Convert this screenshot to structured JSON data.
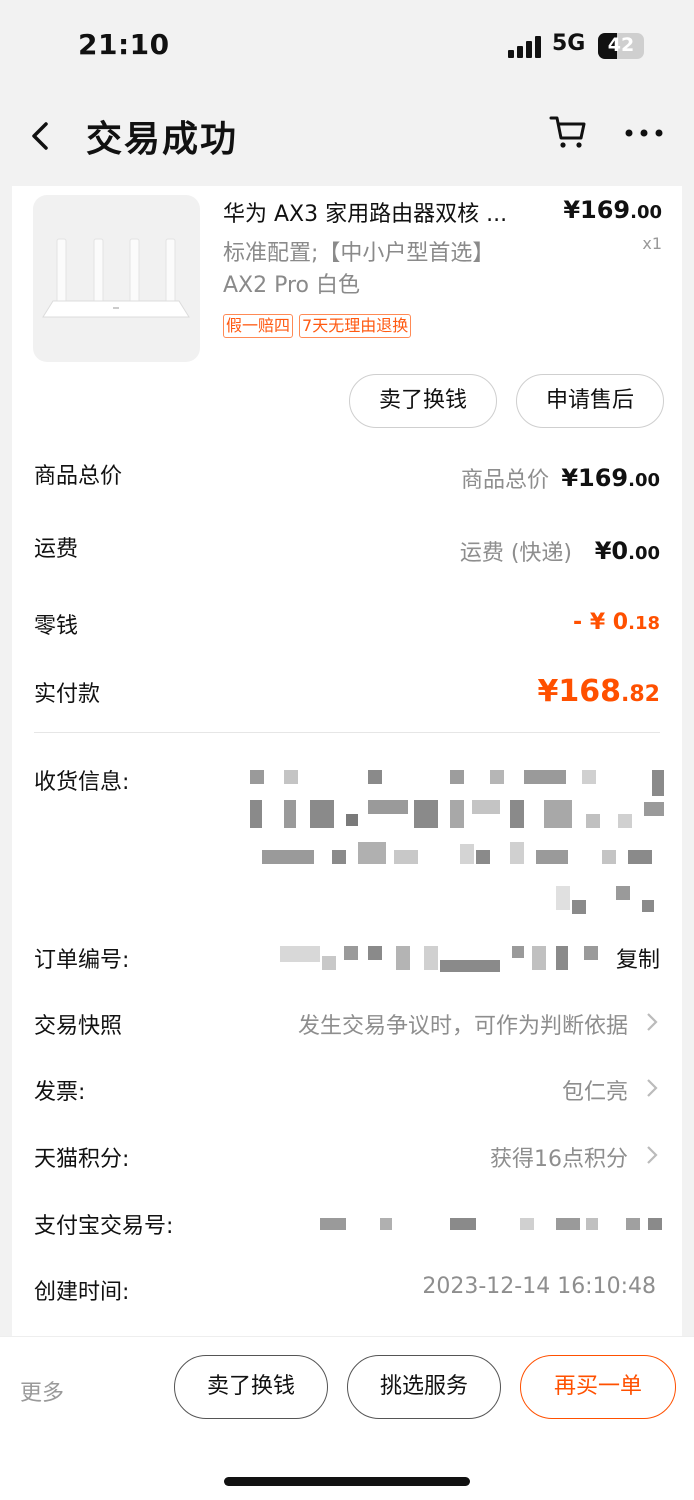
{
  "status_bar": {
    "time": "21:10",
    "network": "5G",
    "battery": "42",
    "battery_level": 0.42
  },
  "nav": {
    "title": "交易成功",
    "icons": [
      "back-icon",
      "cart-icon",
      "more-icon"
    ]
  },
  "product": {
    "title": "华为 AX3 家用路由器双核 ...",
    "price_main": "¥169",
    "price_dec": ".00",
    "qty": "x1",
    "spec_line1": "标准配置;【中小户型首选】",
    "spec_line2": "AX2 Pro 白色",
    "tags": [
      "假一赔四",
      "7天无理由退换"
    ],
    "actions": [
      "卖了换钱",
      "申请售后"
    ]
  },
  "summary": {
    "goods_total": {
      "label": "商品总价",
      "sub": "商品总价",
      "int": "¥169",
      "dec": ".00"
    },
    "shipping": {
      "label": "运费",
      "sub": "运费 (快递)",
      "int": "¥0",
      "dec": ".00"
    },
    "change": {
      "label": "零钱",
      "int": "- ¥ 0",
      "dec": ".18"
    },
    "paid": {
      "label": "实付款",
      "int": "¥168",
      "dec": ".82"
    }
  },
  "info": {
    "address_label": "收货信息:",
    "order_no_label": "订单编号:",
    "copy": "复制",
    "snapshot_label": "交易快照",
    "snapshot_value": "发生交易争议时，可作为判断依据",
    "invoice_label": "发票:",
    "invoice_value": "包仁亮",
    "points_label": "天猫积分:",
    "points_value": "获得16点积分",
    "alipay_label": "支付宝交易号:",
    "created_label": "创建时间:",
    "created_value": "2023-12-14 16:10:48"
  },
  "bottom_bar": {
    "more": "更多",
    "buttons": [
      "卖了换钱",
      "挑选服务",
      "再买一单"
    ]
  },
  "colors": {
    "accent": "#ff5000",
    "text": "#111111",
    "muted": "#8e8e8e",
    "background": "#f2f2f2"
  }
}
